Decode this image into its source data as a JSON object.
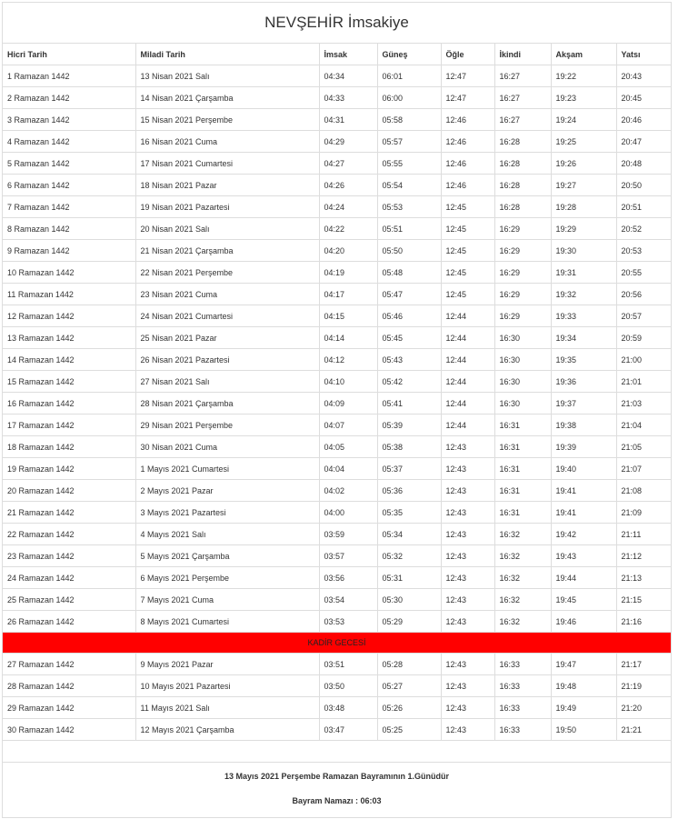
{
  "title": "NEVŞEHİR İmsakiye",
  "columns": [
    "Hicri Tarih",
    "Miladi Tarih",
    "İmsak",
    "Güneş",
    "Öğle",
    "İkindi",
    "Akşam",
    "Yatsı"
  ],
  "rows_before": [
    [
      "1 Ramazan 1442",
      "13 Nisan 2021 Salı",
      "04:34",
      "06:01",
      "12:47",
      "16:27",
      "19:22",
      "20:43"
    ],
    [
      "2 Ramazan 1442",
      "14 Nisan 2021 Çarşamba",
      "04:33",
      "06:00",
      "12:47",
      "16:27",
      "19:23",
      "20:45"
    ],
    [
      "3 Ramazan 1442",
      "15 Nisan 2021 Perşembe",
      "04:31",
      "05:58",
      "12:46",
      "16:27",
      "19:24",
      "20:46"
    ],
    [
      "4 Ramazan 1442",
      "16 Nisan 2021 Cuma",
      "04:29",
      "05:57",
      "12:46",
      "16:28",
      "19:25",
      "20:47"
    ],
    [
      "5 Ramazan 1442",
      "17 Nisan 2021 Cumartesi",
      "04:27",
      "05:55",
      "12:46",
      "16:28",
      "19:26",
      "20:48"
    ],
    [
      "6 Ramazan 1442",
      "18 Nisan 2021 Pazar",
      "04:26",
      "05:54",
      "12:46",
      "16:28",
      "19:27",
      "20:50"
    ],
    [
      "7 Ramazan 1442",
      "19 Nisan 2021 Pazartesi",
      "04:24",
      "05:53",
      "12:45",
      "16:28",
      "19:28",
      "20:51"
    ],
    [
      "8 Ramazan 1442",
      "20 Nisan 2021 Salı",
      "04:22",
      "05:51",
      "12:45",
      "16:29",
      "19:29",
      "20:52"
    ],
    [
      "9 Ramazan 1442",
      "21 Nisan 2021 Çarşamba",
      "04:20",
      "05:50",
      "12:45",
      "16:29",
      "19:30",
      "20:53"
    ],
    [
      "10 Ramazan 1442",
      "22 Nisan 2021 Perşembe",
      "04:19",
      "05:48",
      "12:45",
      "16:29",
      "19:31",
      "20:55"
    ],
    [
      "11 Ramazan 1442",
      "23 Nisan 2021 Cuma",
      "04:17",
      "05:47",
      "12:45",
      "16:29",
      "19:32",
      "20:56"
    ],
    [
      "12 Ramazan 1442",
      "24 Nisan 2021 Cumartesi",
      "04:15",
      "05:46",
      "12:44",
      "16:29",
      "19:33",
      "20:57"
    ],
    [
      "13 Ramazan 1442",
      "25 Nisan 2021 Pazar",
      "04:14",
      "05:45",
      "12:44",
      "16:30",
      "19:34",
      "20:59"
    ],
    [
      "14 Ramazan 1442",
      "26 Nisan 2021 Pazartesi",
      "04:12",
      "05:43",
      "12:44",
      "16:30",
      "19:35",
      "21:00"
    ],
    [
      "15 Ramazan 1442",
      "27 Nisan 2021 Salı",
      "04:10",
      "05:42",
      "12:44",
      "16:30",
      "19:36",
      "21:01"
    ],
    [
      "16 Ramazan 1442",
      "28 Nisan 2021 Çarşamba",
      "04:09",
      "05:41",
      "12:44",
      "16:30",
      "19:37",
      "21:03"
    ],
    [
      "17 Ramazan 1442",
      "29 Nisan 2021 Perşembe",
      "04:07",
      "05:39",
      "12:44",
      "16:31",
      "19:38",
      "21:04"
    ],
    [
      "18 Ramazan 1442",
      "30 Nisan 2021 Cuma",
      "04:05",
      "05:38",
      "12:43",
      "16:31",
      "19:39",
      "21:05"
    ],
    [
      "19 Ramazan 1442",
      "1 Mayıs 2021 Cumartesi",
      "04:04",
      "05:37",
      "12:43",
      "16:31",
      "19:40",
      "21:07"
    ],
    [
      "20 Ramazan 1442",
      "2 Mayıs 2021 Pazar",
      "04:02",
      "05:36",
      "12:43",
      "16:31",
      "19:41",
      "21:08"
    ],
    [
      "21 Ramazan 1442",
      "3 Mayıs 2021 Pazartesi",
      "04:00",
      "05:35",
      "12:43",
      "16:31",
      "19:41",
      "21:09"
    ],
    [
      "22 Ramazan 1442",
      "4 Mayıs 2021 Salı",
      "03:59",
      "05:34",
      "12:43",
      "16:32",
      "19:42",
      "21:11"
    ],
    [
      "23 Ramazan 1442",
      "5 Mayıs 2021 Çarşamba",
      "03:57",
      "05:32",
      "12:43",
      "16:32",
      "19:43",
      "21:12"
    ],
    [
      "24 Ramazan 1442",
      "6 Mayıs 2021 Perşembe",
      "03:56",
      "05:31",
      "12:43",
      "16:32",
      "19:44",
      "21:13"
    ],
    [
      "25 Ramazan 1442",
      "7 Mayıs 2021 Cuma",
      "03:54",
      "05:30",
      "12:43",
      "16:32",
      "19:45",
      "21:15"
    ],
    [
      "26 Ramazan 1442",
      "8 Mayıs 2021 Cumartesi",
      "03:53",
      "05:29",
      "12:43",
      "16:32",
      "19:46",
      "21:16"
    ]
  ],
  "kadir_label": "KADİR GECESİ",
  "kadir_color": "#ff0000",
  "rows_after": [
    [
      "27 Ramazan 1442",
      "9 Mayıs 2021 Pazar",
      "03:51",
      "05:28",
      "12:43",
      "16:33",
      "19:47",
      "21:17"
    ],
    [
      "28 Ramazan 1442",
      "10 Mayıs 2021 Pazartesi",
      "03:50",
      "05:27",
      "12:43",
      "16:33",
      "19:48",
      "21:19"
    ],
    [
      "29 Ramazan 1442",
      "11 Mayıs 2021 Salı",
      "03:48",
      "05:26",
      "12:43",
      "16:33",
      "19:49",
      "21:20"
    ],
    [
      "30 Ramazan 1442",
      "12 Mayıs 2021 Çarşamba",
      "03:47",
      "05:25",
      "12:43",
      "16:33",
      "19:50",
      "21:21"
    ]
  ],
  "footer": {
    "bayram_notice": "13 Mayıs 2021 Perşembe Ramazan Bayramının 1.Günüdür",
    "bayram_namazi": "Bayram Namazı : 06:03"
  }
}
